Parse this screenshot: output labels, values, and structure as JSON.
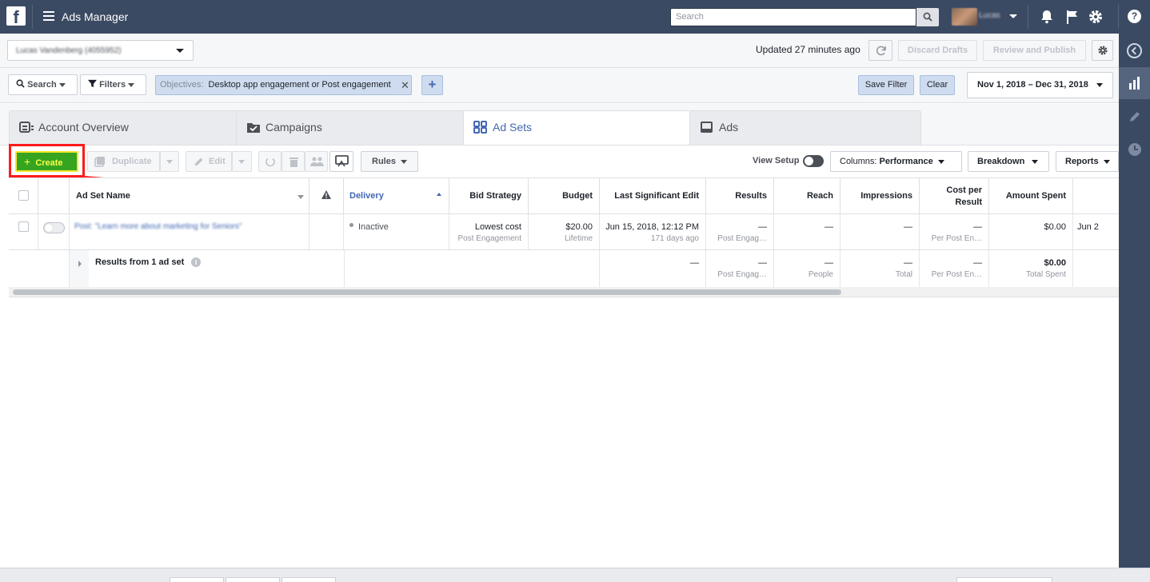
{
  "app": {
    "title": "Ads Manager",
    "logo_letter": "f"
  },
  "topbar": {
    "search_placeholder": "Search",
    "user_name": "Lucas",
    "help": "?"
  },
  "account": {
    "name": "Lucas Vandenberg (4055952)",
    "updated": "Updated 27 minutes ago",
    "discard_drafts": "Discard Drafts",
    "review_publish": "Review and Publish"
  },
  "filters": {
    "search_label": "Search",
    "filters_label": "Filters",
    "chip_key": "Objectives:",
    "chip_value": "Desktop app engagement or Post engagement",
    "chip_remove": "✕",
    "add": "+",
    "save_filter": "Save Filter",
    "clear": "Clear",
    "date_range": "Nov 1, 2018 – Dec 31, 2018"
  },
  "tabs": [
    {
      "label": "Account Overview"
    },
    {
      "label": "Campaigns"
    },
    {
      "label": "Ad Sets"
    },
    {
      "label": "Ads"
    }
  ],
  "toolbar": {
    "create": "Create",
    "duplicate": "Duplicate",
    "edit": "Edit",
    "rules": "Rules",
    "view_setup": "View Setup",
    "columns_prefix": "Columns:",
    "columns_value": "Performance",
    "breakdown": "Breakdown",
    "reports": "Reports"
  },
  "table": {
    "headers": {
      "name": "Ad Set Name",
      "delivery": "Delivery",
      "bid": "Bid Strategy",
      "budget": "Budget",
      "last_edit": "Last Significant Edit",
      "results": "Results",
      "reach": "Reach",
      "impressions": "Impressions",
      "cost_line1": "Cost per",
      "cost_line2": "Result",
      "amount": "Amount Spent"
    },
    "row": {
      "name": "Post: \"Learn more about marketing for Seniors\"",
      "delivery": "Inactive",
      "bid_main": "Lowest cost",
      "bid_sub": "Post Engagement",
      "budget_main": "$20.00",
      "budget_sub": "Lifetime",
      "edit_main": "Jun 15, 2018, 12:12 PM",
      "edit_sub": "171 days ago",
      "results_main": "—",
      "results_sub": "Post Engag…",
      "reach": "—",
      "impressions": "—",
      "cost_main": "—",
      "cost_sub": "Per Post En…",
      "amount": "$0.00",
      "extra": "Jun 2"
    },
    "summary": {
      "label": "Results from 1 ad set",
      "info": "i",
      "edit": "—",
      "results_main": "—",
      "results_sub": "Post Engag…",
      "reach_main": "—",
      "reach_sub": "People",
      "impr_main": "—",
      "impr_sub": "Total",
      "cost_main": "—",
      "cost_sub": "Per Post En…",
      "amount_main": "$0.00",
      "amount_sub": "Total Spent"
    }
  },
  "colors": {
    "topbar": "#3b4a63",
    "create_green": "#36a420",
    "highlight_red": "#ff1a1a",
    "active_tab_blue": "#4267b2"
  }
}
